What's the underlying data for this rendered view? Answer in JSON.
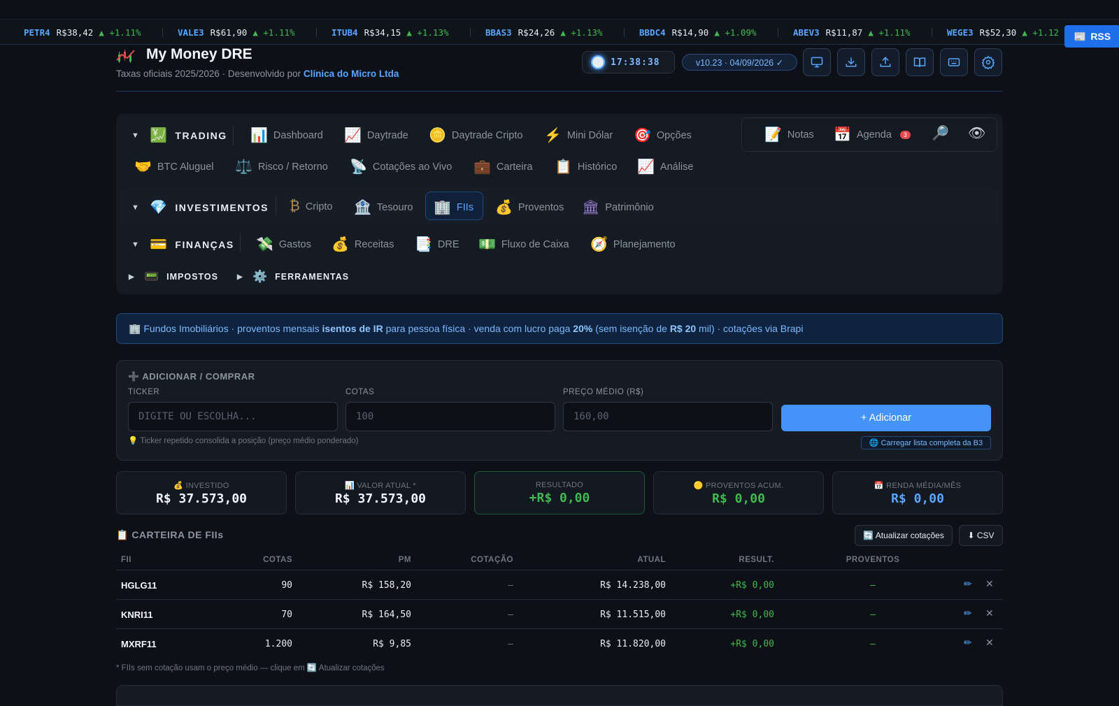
{
  "ticker": [
    {
      "symbol": "PETR4",
      "price": "R$38,42",
      "change": "▲ +1.11%"
    },
    {
      "symbol": "VALE3",
      "price": "R$61,90",
      "change": "▲ +1.11%"
    },
    {
      "symbol": "ITUB4",
      "price": "R$34,15",
      "change": "▲ +1.13%"
    },
    {
      "symbol": "BBAS3",
      "price": "R$24,26",
      "change": "▲ +1.13%"
    },
    {
      "symbol": "BBDC4",
      "price": "R$14,90",
      "change": "▲ +1.09%"
    },
    {
      "symbol": "ABEV3",
      "price": "R$11,87",
      "change": "▲ +1.11%"
    },
    {
      "symbol": "WEGE3",
      "price": "R$52,30",
      "change": "▲ +1.12"
    }
  ],
  "rss_label": "RSS",
  "header": {
    "title": "My Money DRE",
    "subtitle_prefix": "Taxas oficiais 2025/2026 · Desenvolvido por ",
    "subtitle_company": "Clínica do Micro Ltda",
    "clock": "17:38:38",
    "version": "v10.23 · 04/09/2026 ✓"
  },
  "nav": {
    "trading": {
      "label": "TRADING",
      "items": [
        "Dashboard",
        "Daytrade",
        "Daytrade Cripto",
        "Mini Dólar",
        "Opções",
        "BTC Aluguel",
        "Risco / Retorno",
        "Cotações ao Vivo",
        "Carteira",
        "Histórico",
        "Análise"
      ]
    },
    "investimentos": {
      "label": "INVESTIMENTOS",
      "items": [
        "Cripto",
        "Tesouro",
        "FIIs",
        "Proventos",
        "Patrimônio"
      ]
    },
    "financas": {
      "label": "FINANÇAS",
      "items": [
        "Gastos",
        "Receitas",
        "DRE",
        "Fluxo de Caixa",
        "Planejamento"
      ]
    },
    "impostos": "IMPOSTOS",
    "ferramentas": "FERRAMENTAS",
    "quick": {
      "notas": "Notas",
      "agenda": "Agenda",
      "agenda_badge": "3"
    }
  },
  "info": {
    "p1": "🏢 Fundos Imobiliários · proventos mensais ",
    "b1": "isentos de IR",
    "p2": " para pessoa física · venda com lucro paga ",
    "b2": "20%",
    "p3": " (sem isenção de ",
    "b3": "R$ 20",
    "p4": " mil) · cotações via Brapi"
  },
  "add_form": {
    "title": "➕ ADICIONAR / COMPRAR",
    "ticker_label": "TICKER",
    "ticker_placeholder": "DIGITE OU ESCOLHA...",
    "cotas_label": "COTAS",
    "cotas_placeholder": "100",
    "preco_label": "PREÇO MÉDIO (R$)",
    "preco_placeholder": "160,00",
    "button": "+ Adicionar",
    "hint": "💡 Ticker repetido consolida a posição (preço médio ponderado)",
    "load_b3": "🌐 Carregar lista completa da B3"
  },
  "summary": [
    {
      "label": "💰 INVESTIDO",
      "value": "R$ 37.573,00"
    },
    {
      "label": "📊 VALOR ATUAL *",
      "value": "R$ 37.573,00"
    },
    {
      "label": "RESULTADO",
      "value": "+R$ 0,00"
    },
    {
      "label": "🟡 PROVENTOS ACUM.",
      "value": "R$ 0,00"
    },
    {
      "label": "📅 RENDA MÉDIA/MÊS",
      "value": "R$ 0,00"
    }
  ],
  "wallet": {
    "title": "📋 CARTEIRA DE FIIs",
    "refresh": "🔄 Atualizar cotações",
    "csv": "⬇ CSV",
    "columns": [
      "FII",
      "COTAS",
      "PM",
      "COTAÇÃO",
      "ATUAL",
      "RESULT.",
      "PROVENTOS"
    ],
    "rows": [
      [
        "HGLG11",
        "90",
        "R$ 158,20",
        "–",
        "R$ 14.238,00",
        "+R$ 0,00",
        "–"
      ],
      [
        "KNRI11",
        "70",
        "R$ 164,50",
        "–",
        "R$ 11.515,00",
        "+R$ 0,00",
        "–"
      ],
      [
        "MXRF11",
        "1.200",
        "R$ 9,85",
        "–",
        "R$ 11.820,00",
        "+R$ 0,00",
        "–"
      ]
    ],
    "footnote": "* FIIs sem cotação usam o preço médio — clique em 🔄 Atualizar cotações"
  },
  "colors": {
    "accent": "#58a6ff",
    "positive": "#3fb950",
    "background": "#0d1117"
  }
}
